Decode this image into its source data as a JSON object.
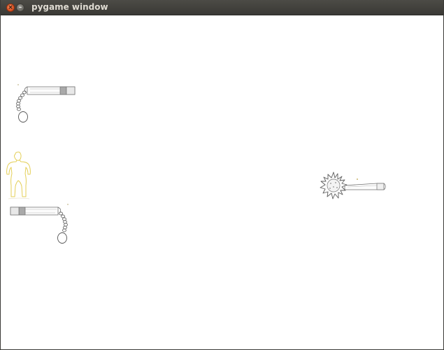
{
  "window": {
    "title": "pygame window",
    "buttons": [
      {
        "name": "close",
        "icon": "close-icon",
        "glyph": "×",
        "color": "#e05a24"
      },
      {
        "name": "minimize",
        "icon": "minimize-icon",
        "glyph": "–",
        "color": "#7a7973"
      }
    ]
  },
  "game": {
    "background": "#ffffff",
    "sprites": [
      {
        "name": "flail-top-left",
        "icon": "ball-and-chain-flail"
      },
      {
        "name": "player-character",
        "icon": "stick-figure-outline"
      },
      {
        "name": "flail-bottom-left",
        "icon": "ball-and-chain-flail"
      },
      {
        "name": "spiked-mace",
        "icon": "spiked-mace"
      }
    ]
  }
}
